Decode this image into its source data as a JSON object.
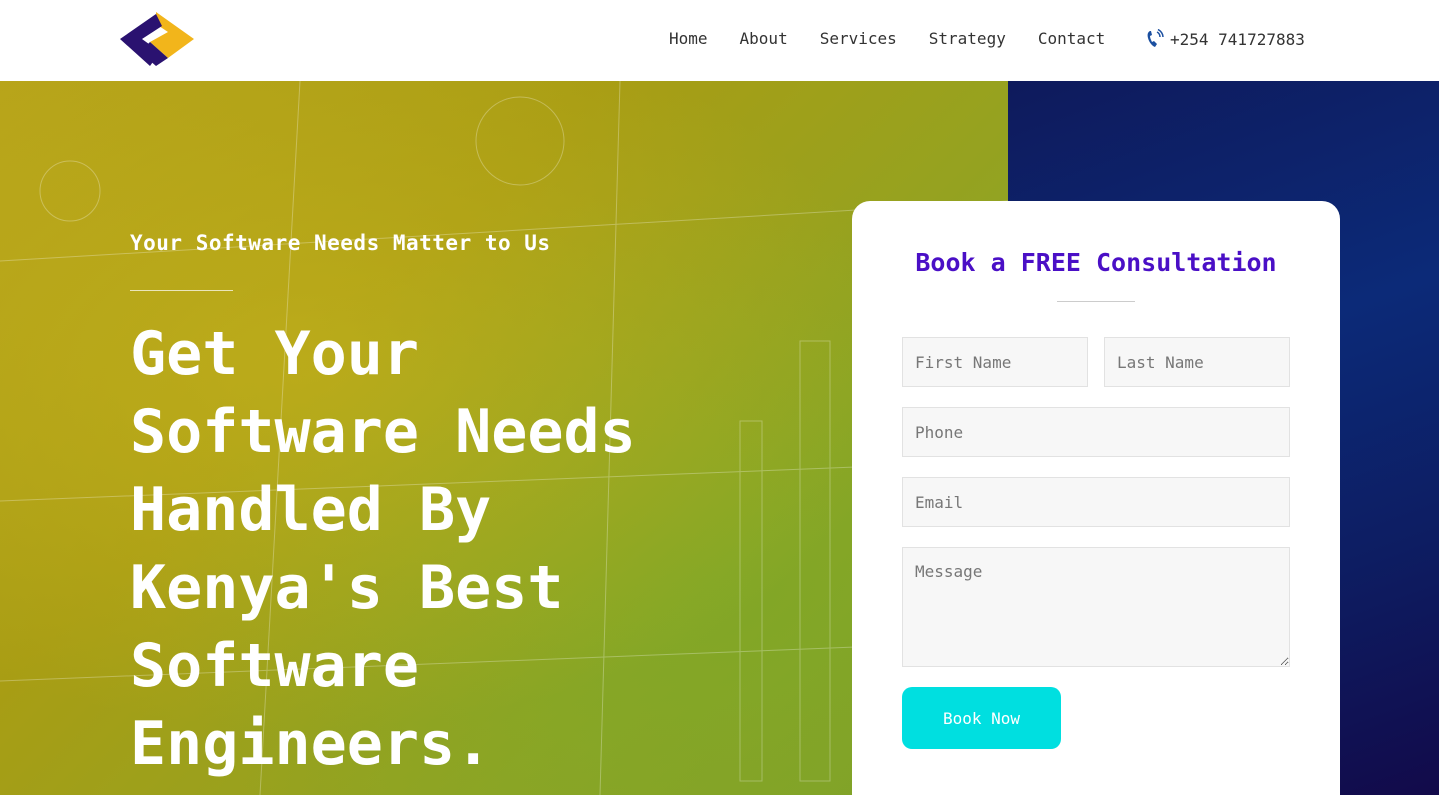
{
  "header": {
    "logo_icon": "diamond-logo-icon",
    "nav": [
      {
        "label": "Home"
      },
      {
        "label": "About"
      },
      {
        "label": "Services"
      },
      {
        "label": "Strategy"
      },
      {
        "label": "Contact"
      }
    ],
    "phone": {
      "icon": "phone-icon",
      "number": "+254 741727883"
    }
  },
  "hero": {
    "tagline": "Your Software Needs Matter to Us",
    "headline": "Get Your Software Needs Handled By Kenya's Best Software Engineers."
  },
  "form": {
    "title": "Book a FREE Consultation",
    "first_name_placeholder": "First Name",
    "last_name_placeholder": "Last Name",
    "phone_placeholder": "Phone",
    "email_placeholder": "Email",
    "message_placeholder": "Message",
    "submit_label": "Book Now"
  },
  "colors": {
    "accent_purple": "#4a0fc6",
    "button_cyan": "#00dfe0",
    "logo_yellow": "#f2b51b",
    "logo_navy": "#2a1270"
  }
}
